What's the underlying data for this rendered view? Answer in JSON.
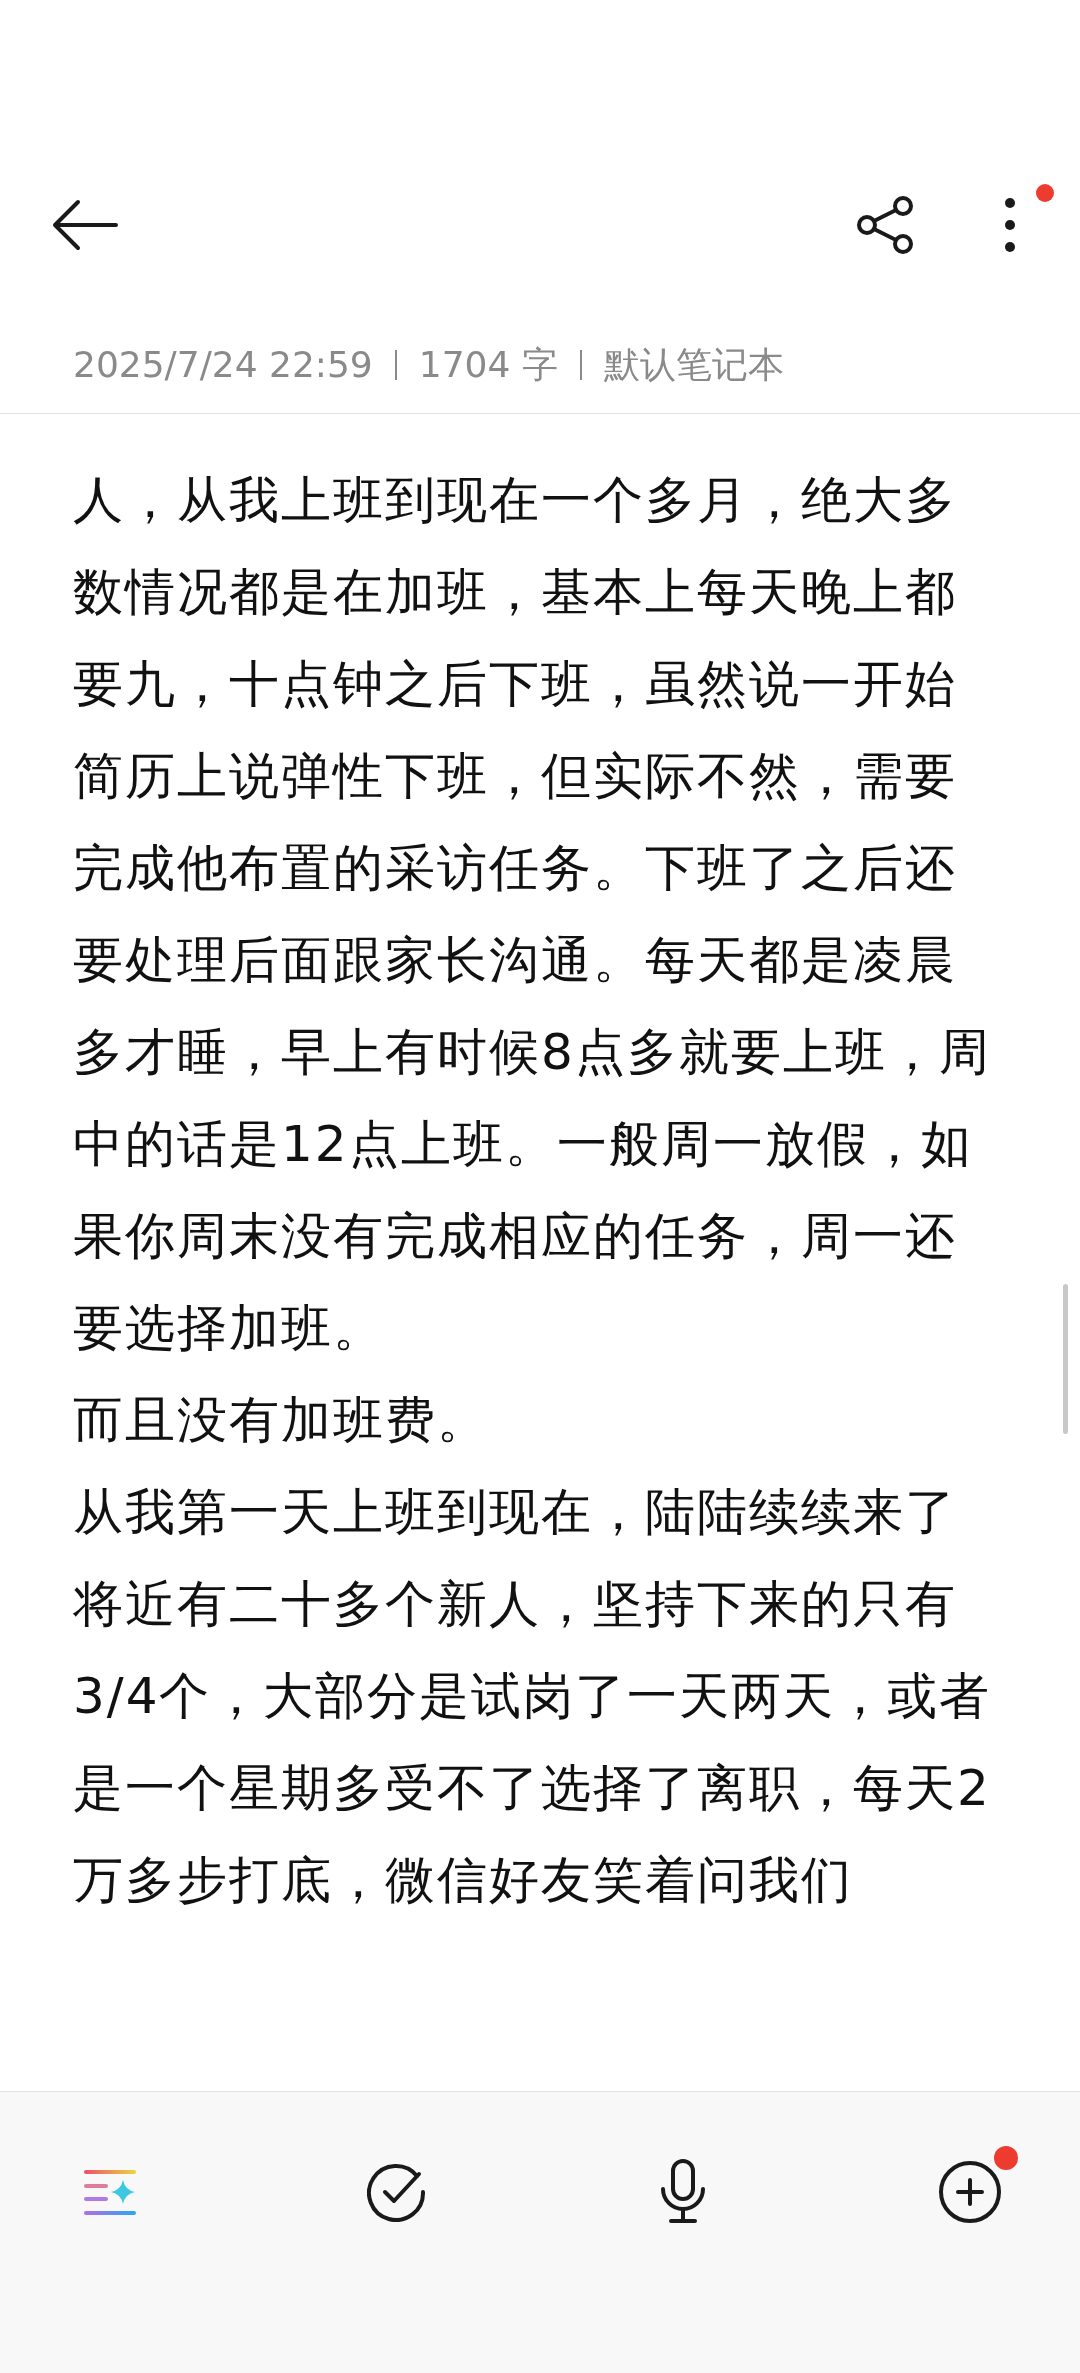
{
  "meta": {
    "date": "2025/7/24 22:59",
    "count": "1704 字",
    "notebook": "默认笔记本"
  },
  "header": {
    "more_badge": true
  },
  "paragraphs": [
    "人，从我上班到现在一个多月，绝大多数情况都是在加班，基本上每天晚上都要九，十点钟之后下班，虽然说一开始简历上说弹性下班，但实际不然，需要完成他布置的采访任务。下班了之后还要处理后面跟家长沟通。每天都是凌晨多才睡，早上有时候8点多就要上班，周中的话是12点上班。一般周一放假，如果你周末没有完成相应的任务，周一还要选择加班。",
    "而且没有加班费。",
    "从我第一天上班到现在，陆陆续续来了将近有二十多个新人，坚持下来的只有3/4个，大部分是试岗了一天两天，或者是一个星期多受不了选择了离职，每天2万多步打底，微信好友笑着问我们"
  ],
  "toolbar": [
    {
      "kind": "ai",
      "badge": false
    },
    {
      "kind": "check",
      "badge": false
    },
    {
      "kind": "mic",
      "badge": false
    },
    {
      "kind": "add",
      "badge": true
    }
  ]
}
